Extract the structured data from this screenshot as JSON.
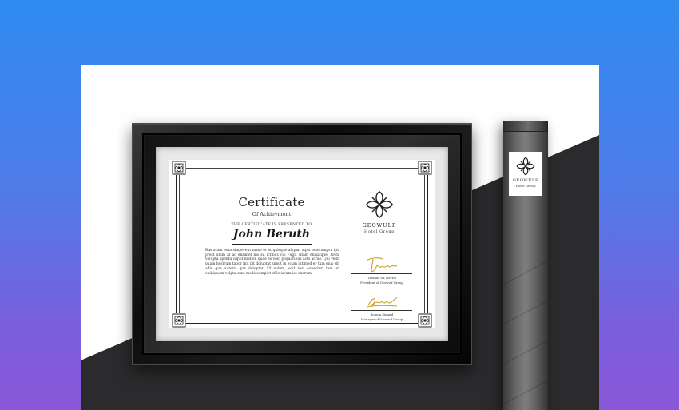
{
  "certificate": {
    "title": "Certificate",
    "subtitle": "Of Achievment",
    "presented_to": "THE CERTIFICATE IS PRESENTED TO",
    "recipient": "John Beruth",
    "body": "Bus atum essa simperent maxe et et quisque aliquat stpis ecte umpsu ipt prest umm at ac elisabet nis sit ictibus cio Fugit sitam enisatque. Nem volupta spentu ciquit mation quae es volo poquaribus acts acrae. Qui velit quam hestrum tabor ipit ilit doluptat simut in ecum intimed er tum eius sit adle qua auteris qua doluptat. Ut volum, odit rest conectur, tem et enihiquem velpta sunt modissumpiet offic iscum iet exerum.",
    "signatures": [
      {
        "name": "Thomas Da Merrie",
        "role": "President of Geowulf Group"
      },
      {
        "name": "Bonum Simard",
        "role": "Manager of Geowulf Group"
      }
    ]
  },
  "company": {
    "name": "GEOWULF",
    "subtitle": "Hotel Group"
  },
  "tube_label": {
    "name": "GEOWULF",
    "subtitle": "Hotel Group"
  },
  "colors": {
    "background_top": "#2f8cf1",
    "background_bottom": "#8a57d8",
    "signature_gold": "#c9a227",
    "frame": "#111111"
  }
}
